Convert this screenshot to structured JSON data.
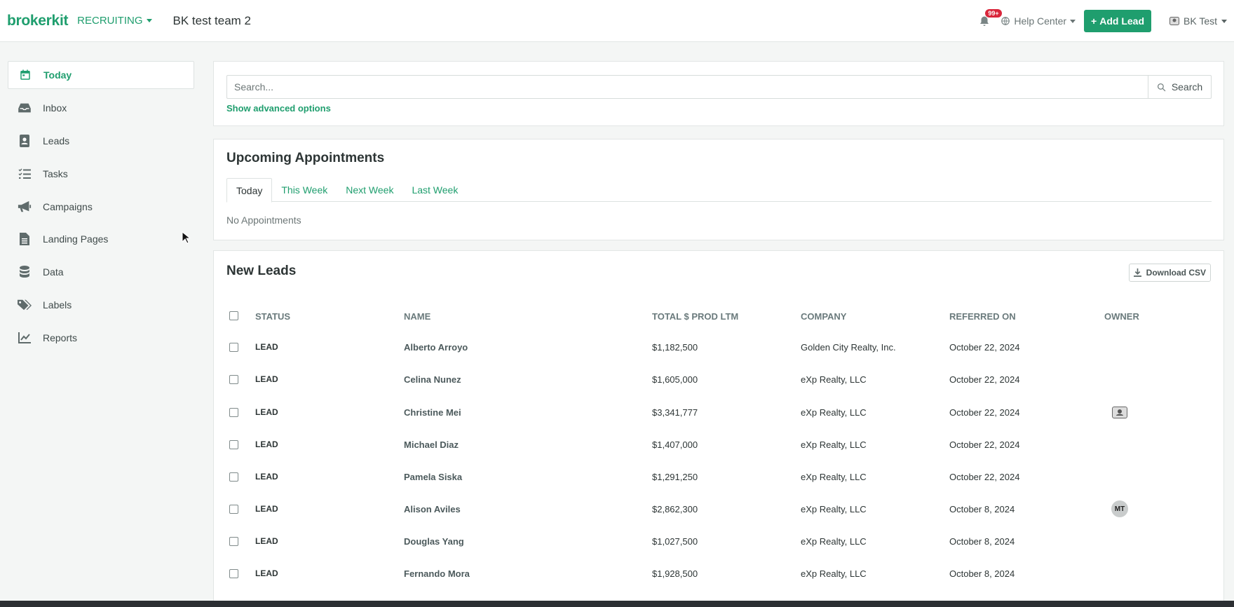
{
  "header": {
    "logo": "brokerkit",
    "module": "RECRUITING",
    "team": "BK test team 2",
    "notification_badge": "99+",
    "help_label": "Help Center",
    "add_lead_label": "Add Lead",
    "user_label": "BK Test"
  },
  "sidebar": {
    "items": [
      {
        "label": "Today",
        "icon": "calendar-icon",
        "active": true
      },
      {
        "label": "Inbox",
        "icon": "inbox-icon"
      },
      {
        "label": "Leads",
        "icon": "contact-card-icon"
      },
      {
        "label": "Tasks",
        "icon": "task-list-icon"
      },
      {
        "label": "Campaigns",
        "icon": "megaphone-icon"
      },
      {
        "label": "Landing Pages",
        "icon": "document-icon"
      },
      {
        "label": "Data",
        "icon": "database-icon"
      },
      {
        "label": "Labels",
        "icon": "tags-icon"
      },
      {
        "label": "Reports",
        "icon": "chart-line-icon"
      }
    ]
  },
  "search": {
    "placeholder": "Search...",
    "button_label": "Search",
    "advanced_link": "Show advanced options"
  },
  "appointments": {
    "title": "Upcoming Appointments",
    "tabs": [
      "Today",
      "This Week",
      "Next Week",
      "Last Week"
    ],
    "active_tab": "Today",
    "empty_text": "No Appointments"
  },
  "new_leads": {
    "title": "New Leads",
    "download_label": "Download CSV",
    "columns": [
      "STATUS",
      "NAME",
      "TOTAL $ PROD LTM",
      "COMPANY",
      "REFERRED ON",
      "OWNER"
    ],
    "rows": [
      {
        "status": "LEAD",
        "name": "Alberto Arroyo",
        "prod": "$1,182,500",
        "company": "Golden City Realty, Inc.",
        "referred": "October 22, 2024",
        "owner": ""
      },
      {
        "status": "LEAD",
        "name": "Celina Nunez",
        "prod": "$1,605,000",
        "company": "eXp Realty, LLC",
        "referred": "October 22, 2024",
        "owner": ""
      },
      {
        "status": "LEAD",
        "name": "Christine Mei",
        "prod": "$3,341,777",
        "company": "eXp Realty, LLC",
        "referred": "October 22, 2024",
        "owner": "image-avatar"
      },
      {
        "status": "LEAD",
        "name": "Michael Diaz",
        "prod": "$1,407,000",
        "company": "eXp Realty, LLC",
        "referred": "October 22, 2024",
        "owner": ""
      },
      {
        "status": "LEAD",
        "name": "Pamela Siska",
        "prod": "$1,291,250",
        "company": "eXp Realty, LLC",
        "referred": "October 22, 2024",
        "owner": ""
      },
      {
        "status": "LEAD",
        "name": "Alison Aviles",
        "prod": "$2,862,300",
        "company": "eXp Realty, LLC",
        "referred": "October 8, 2024",
        "owner": "MT"
      },
      {
        "status": "LEAD",
        "name": "Douglas Yang",
        "prod": "$1,027,500",
        "company": "eXp Realty, LLC",
        "referred": "October 8, 2024",
        "owner": ""
      },
      {
        "status": "LEAD",
        "name": "Fernando Mora",
        "prod": "$1,928,500",
        "company": "eXp Realty, LLC",
        "referred": "October 8, 2024",
        "owner": ""
      }
    ]
  },
  "colors": {
    "brand": "#1f9e6e",
    "badge": "#d9263b"
  }
}
